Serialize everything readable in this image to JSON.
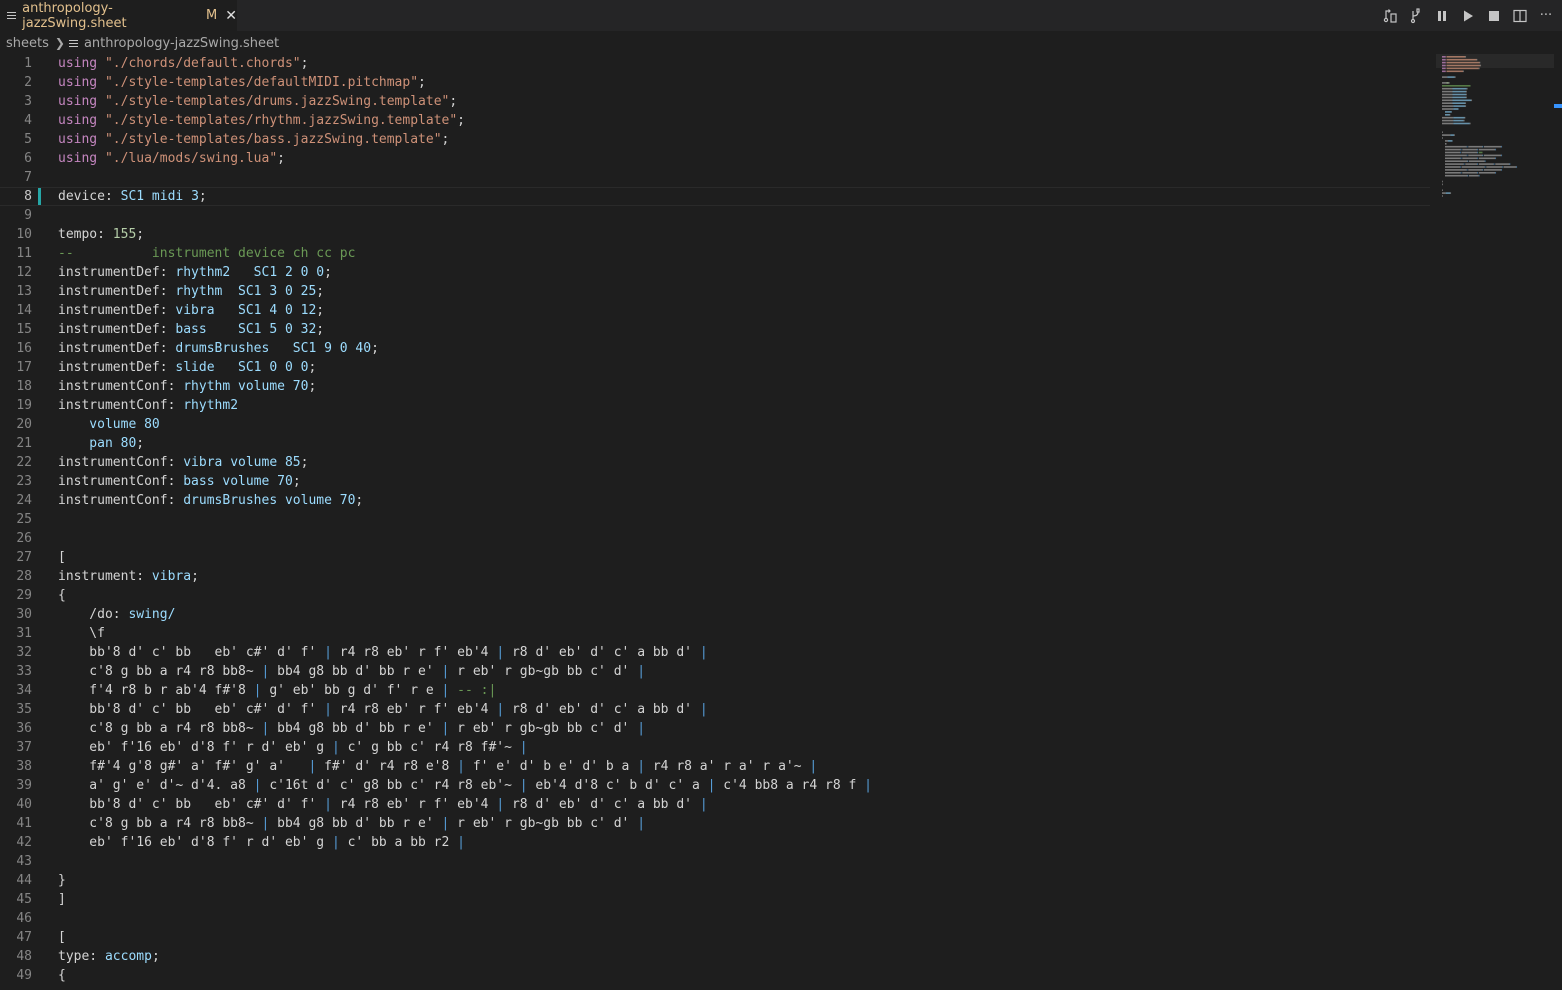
{
  "tab": {
    "title": "anthropology-jazzSwing.sheet",
    "modified": "M",
    "close": "✕"
  },
  "breadcrumb": {
    "folder": "sheets",
    "file": "anthropology-jazzSwing.sheet"
  },
  "actions": [
    "source-control-compare-icon",
    "branch-icon",
    "pause-icon",
    "play-icon",
    "stop-icon",
    "split-editor-icon",
    "more-actions-icon"
  ],
  "more_label": "···",
  "editor": {
    "active_line": 8,
    "lines": [
      {
        "n": 1,
        "t": [
          [
            "kw",
            "using"
          ],
          [
            "fld",
            " "
          ],
          [
            "str",
            "\"./chords/default.chords\""
          ],
          [
            "fld",
            ";"
          ]
        ]
      },
      {
        "n": 2,
        "t": [
          [
            "kw",
            "using"
          ],
          [
            "fld",
            " "
          ],
          [
            "str",
            "\"./style-templates/defaultMIDI.pitchmap\""
          ],
          [
            "fld",
            ";"
          ]
        ]
      },
      {
        "n": 3,
        "t": [
          [
            "kw",
            "using"
          ],
          [
            "fld",
            " "
          ],
          [
            "str",
            "\"./style-templates/drums.jazzSwing.template\""
          ],
          [
            "fld",
            ";"
          ]
        ]
      },
      {
        "n": 4,
        "t": [
          [
            "kw",
            "using"
          ],
          [
            "fld",
            " "
          ],
          [
            "str",
            "\"./style-templates/rhythm.jazzSwing.template\""
          ],
          [
            "fld",
            ";"
          ]
        ]
      },
      {
        "n": 5,
        "t": [
          [
            "kw",
            "using"
          ],
          [
            "fld",
            " "
          ],
          [
            "str",
            "\"./style-templates/bass.jazzSwing.template\""
          ],
          [
            "fld",
            ";"
          ]
        ]
      },
      {
        "n": 6,
        "t": [
          [
            "kw",
            "using"
          ],
          [
            "fld",
            " "
          ],
          [
            "str",
            "\"./lua/mods/swing.lua\""
          ],
          [
            "fld",
            ";"
          ]
        ]
      },
      {
        "n": 7,
        "t": []
      },
      {
        "n": 8,
        "t": [
          [
            "fld",
            "device: "
          ],
          [
            "id",
            "SC1 midi 3"
          ],
          [
            "fld",
            ";"
          ]
        ]
      },
      {
        "n": 9,
        "t": []
      },
      {
        "n": 10,
        "t": [
          [
            "fld",
            "tempo: "
          ],
          [
            "num",
            "155"
          ],
          [
            "fld",
            ";"
          ]
        ]
      },
      {
        "n": 11,
        "t": [
          [
            "cm",
            "--          instrument device ch cc pc"
          ]
        ]
      },
      {
        "n": 12,
        "t": [
          [
            "fld",
            "instrumentDef: "
          ],
          [
            "id",
            "rhythm2   SC1 2 0 0"
          ],
          [
            "fld",
            ";"
          ]
        ]
      },
      {
        "n": 13,
        "t": [
          [
            "fld",
            "instrumentDef: "
          ],
          [
            "id",
            "rhythm  SC1 3 0 25"
          ],
          [
            "fld",
            ";"
          ]
        ]
      },
      {
        "n": 14,
        "t": [
          [
            "fld",
            "instrumentDef: "
          ],
          [
            "id",
            "vibra   SC1 4 0 12"
          ],
          [
            "fld",
            ";"
          ]
        ]
      },
      {
        "n": 15,
        "t": [
          [
            "fld",
            "instrumentDef: "
          ],
          [
            "id",
            "bass    SC1 5 0 32"
          ],
          [
            "fld",
            ";"
          ]
        ]
      },
      {
        "n": 16,
        "t": [
          [
            "fld",
            "instrumentDef: "
          ],
          [
            "id",
            "drumsBrushes   SC1 9 0 40"
          ],
          [
            "fld",
            ";"
          ]
        ]
      },
      {
        "n": 17,
        "t": [
          [
            "fld",
            "instrumentDef: "
          ],
          [
            "id",
            "slide   SC1 0 0 0"
          ],
          [
            "fld",
            ";"
          ]
        ]
      },
      {
        "n": 18,
        "t": [
          [
            "fld",
            "instrumentConf: "
          ],
          [
            "id",
            "rhythm volume 70"
          ],
          [
            "fld",
            ";"
          ]
        ]
      },
      {
        "n": 19,
        "t": [
          [
            "fld",
            "instrumentConf: "
          ],
          [
            "id",
            "rhythm2"
          ]
        ]
      },
      {
        "n": 20,
        "t": [
          [
            "id",
            "    volume 80"
          ]
        ]
      },
      {
        "n": 21,
        "t": [
          [
            "id",
            "    pan 80"
          ],
          [
            "fld",
            ";"
          ]
        ]
      },
      {
        "n": 22,
        "t": [
          [
            "fld",
            "instrumentConf: "
          ],
          [
            "id",
            "vibra volume 85"
          ],
          [
            "fld",
            ";"
          ]
        ]
      },
      {
        "n": 23,
        "t": [
          [
            "fld",
            "instrumentConf: "
          ],
          [
            "id",
            "bass volume 70"
          ],
          [
            "fld",
            ";"
          ]
        ]
      },
      {
        "n": 24,
        "t": [
          [
            "fld",
            "instrumentConf: "
          ],
          [
            "id",
            "drumsBrushes volume 70"
          ],
          [
            "fld",
            ";"
          ]
        ]
      },
      {
        "n": 25,
        "t": []
      },
      {
        "n": 26,
        "t": []
      },
      {
        "n": 27,
        "t": [
          [
            "fld",
            "["
          ]
        ]
      },
      {
        "n": 28,
        "t": [
          [
            "fld",
            "instrument: "
          ],
          [
            "id",
            "vibra"
          ],
          [
            "fld",
            ";"
          ]
        ]
      },
      {
        "n": 29,
        "t": [
          [
            "fld",
            "{"
          ]
        ]
      },
      {
        "n": 30,
        "t": [
          [
            "fld",
            "    /do: "
          ],
          [
            "id",
            "swing/"
          ]
        ]
      },
      {
        "n": 31,
        "t": [
          [
            "fld",
            "    \\f"
          ]
        ]
      },
      {
        "n": 32,
        "t": [
          [
            "note",
            "    bb'8 d' c' bb   eb' c#' d' f' "
          ],
          [
            "bar",
            "|"
          ],
          [
            "note",
            " r4 r8 eb' r f' eb'4 "
          ],
          [
            "bar",
            "|"
          ],
          [
            "note",
            " r8 d' eb' d' c' a bb d' "
          ],
          [
            "bar",
            "|"
          ]
        ]
      },
      {
        "n": 33,
        "t": [
          [
            "note",
            "    c'8 g bb a r4 r8 bb8~ "
          ],
          [
            "bar",
            "|"
          ],
          [
            "note",
            " bb4 g8 bb d' bb r e' "
          ],
          [
            "bar",
            "|"
          ],
          [
            "note",
            " r eb' r gb~gb bb c' d' "
          ],
          [
            "bar",
            "|"
          ]
        ]
      },
      {
        "n": 34,
        "t": [
          [
            "note",
            "    f'4 r8 b r ab'4 f#'8 "
          ],
          [
            "bar",
            "|"
          ],
          [
            "note",
            " g' eb' bb g d' f' r e "
          ],
          [
            "bar",
            "|"
          ],
          [
            "cm",
            " -- :|"
          ]
        ]
      },
      {
        "n": 35,
        "t": [
          [
            "note",
            "    bb'8 d' c' bb   eb' c#' d' f' "
          ],
          [
            "bar",
            "|"
          ],
          [
            "note",
            " r4 r8 eb' r f' eb'4 "
          ],
          [
            "bar",
            "|"
          ],
          [
            "note",
            " r8 d' eb' d' c' a bb d' "
          ],
          [
            "bar",
            "|"
          ]
        ]
      },
      {
        "n": 36,
        "t": [
          [
            "note",
            "    c'8 g bb a r4 r8 bb8~ "
          ],
          [
            "bar",
            "|"
          ],
          [
            "note",
            " bb4 g8 bb d' bb r e' "
          ],
          [
            "bar",
            "|"
          ],
          [
            "note",
            " r eb' r gb~gb bb c' d' "
          ],
          [
            "bar",
            "|"
          ]
        ]
      },
      {
        "n": 37,
        "t": [
          [
            "note",
            "    eb' f'16 eb' d'8 f' r d' eb' g "
          ],
          [
            "bar",
            "|"
          ],
          [
            "note",
            " c' g bb c' r4 r8 f#'~ "
          ],
          [
            "bar",
            "|"
          ]
        ]
      },
      {
        "n": 38,
        "t": [
          [
            "note",
            "    f#'4 g'8 g#' a' f#' g' a'   "
          ],
          [
            "bar",
            "|"
          ],
          [
            "note",
            " f#' d' r4 r8 e'8 "
          ],
          [
            "bar",
            "|"
          ],
          [
            "note",
            " f' e' d' b e' d' b a "
          ],
          [
            "bar",
            "|"
          ],
          [
            "note",
            " r4 r8 a' r a' r a'~ "
          ],
          [
            "bar",
            "|"
          ]
        ]
      },
      {
        "n": 39,
        "t": [
          [
            "note",
            "    a' g' e' d'~ d'4. a8 "
          ],
          [
            "bar",
            "|"
          ],
          [
            "note",
            " c'16t d' c' g8 bb c' r4 r8 eb'~ "
          ],
          [
            "bar",
            "|"
          ],
          [
            "note",
            " eb'4 d'8 c' b d' c' a "
          ],
          [
            "bar",
            "|"
          ],
          [
            "note",
            " c'4 bb8 a r4 r8 f "
          ],
          [
            "bar",
            "|"
          ]
        ]
      },
      {
        "n": 40,
        "t": [
          [
            "note",
            "    bb'8 d' c' bb   eb' c#' d' f' "
          ],
          [
            "bar",
            "|"
          ],
          [
            "note",
            " r4 r8 eb' r f' eb'4 "
          ],
          [
            "bar",
            "|"
          ],
          [
            "note",
            " r8 d' eb' d' c' a bb d' "
          ],
          [
            "bar",
            "|"
          ]
        ]
      },
      {
        "n": 41,
        "t": [
          [
            "note",
            "    c'8 g bb a r4 r8 bb8~ "
          ],
          [
            "bar",
            "|"
          ],
          [
            "note",
            " bb4 g8 bb d' bb r e' "
          ],
          [
            "bar",
            "|"
          ],
          [
            "note",
            " r eb' r gb~gb bb c' d' "
          ],
          [
            "bar",
            "|"
          ]
        ]
      },
      {
        "n": 42,
        "t": [
          [
            "note",
            "    eb' f'16 eb' d'8 f' r d' eb' g "
          ],
          [
            "bar",
            "|"
          ],
          [
            "note",
            " c' bb a bb r2 "
          ],
          [
            "bar",
            "|"
          ]
        ]
      },
      {
        "n": 43,
        "t": []
      },
      {
        "n": 44,
        "t": [
          [
            "fld",
            "}"
          ]
        ]
      },
      {
        "n": 45,
        "t": [
          [
            "fld",
            "]"
          ]
        ]
      },
      {
        "n": 46,
        "t": []
      },
      {
        "n": 47,
        "t": [
          [
            "fld",
            "["
          ]
        ]
      },
      {
        "n": 48,
        "t": [
          [
            "fld",
            "type: "
          ],
          [
            "id",
            "accomp"
          ],
          [
            "fld",
            ";"
          ]
        ]
      },
      {
        "n": 49,
        "t": [
          [
            "fld",
            "{"
          ]
        ]
      }
    ]
  }
}
